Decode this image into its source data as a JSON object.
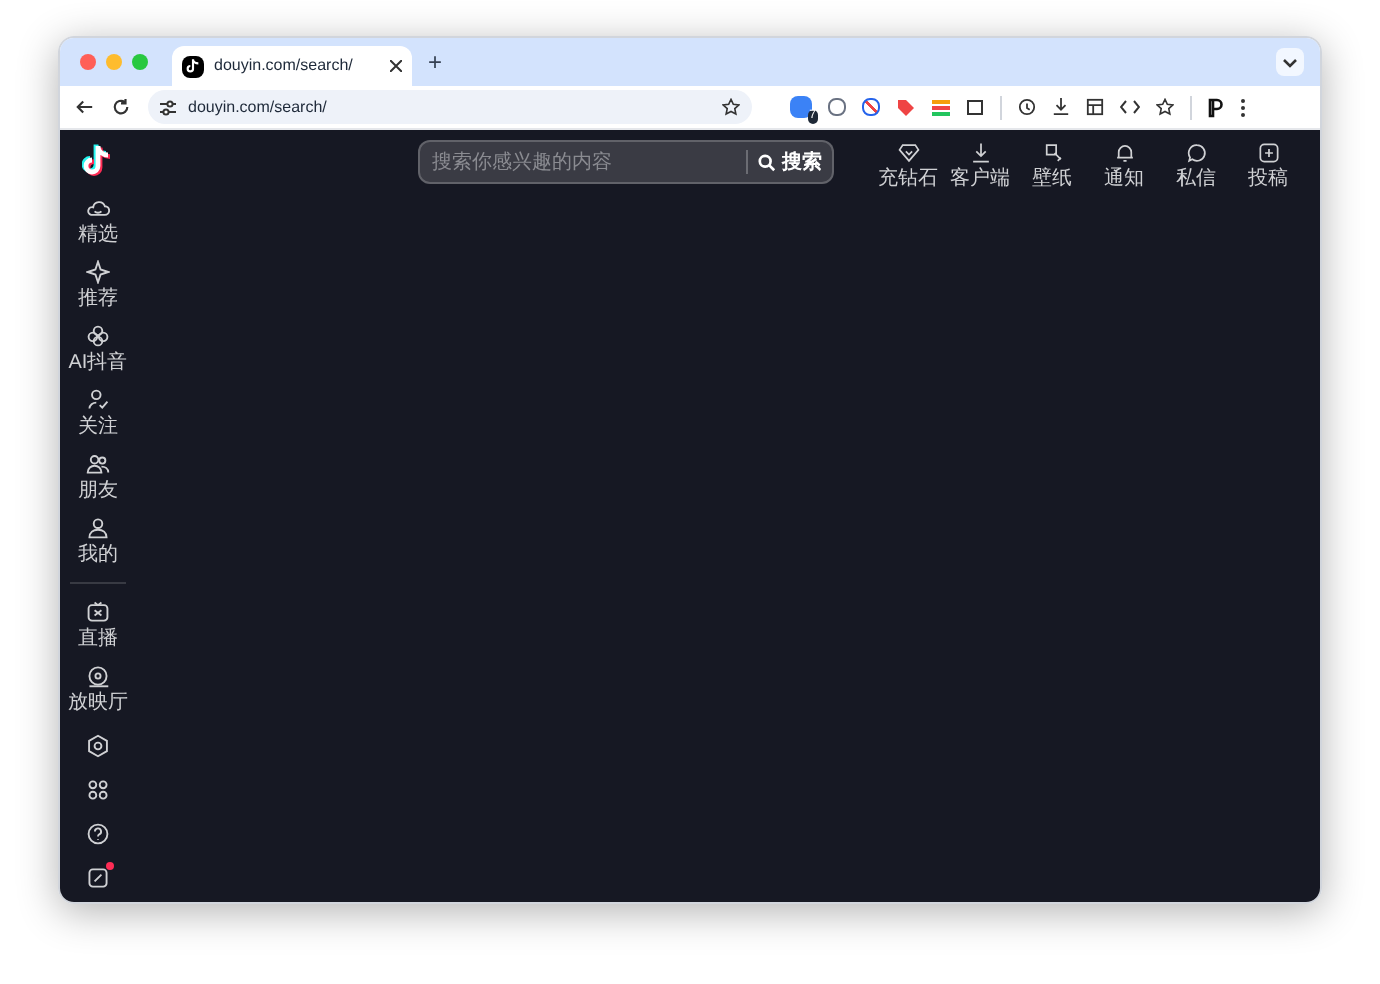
{
  "browser": {
    "tab": {
      "title": "douyin.com/search/",
      "selected": true
    },
    "new_tab": "+",
    "url": "douyin.com/search/",
    "extension_badge": "7"
  },
  "sidebar": {
    "top": [
      {
        "kind": "home",
        "label": "精选",
        "selected": false
      },
      {
        "kind": "spark",
        "label": "推荐",
        "selected": false
      },
      {
        "kind": "ai",
        "label": "AI抖音",
        "selected": false
      },
      {
        "kind": "follow",
        "label": "关注",
        "selected": false
      },
      {
        "kind": "friends",
        "label": "朋友",
        "selected": false
      },
      {
        "kind": "me",
        "label": "我的",
        "selected": false
      }
    ],
    "middle": [
      {
        "kind": "live",
        "label": "直播",
        "selected": false
      },
      {
        "kind": "cinema",
        "label": "放映厅",
        "selected": false
      }
    ],
    "bottom": [
      {
        "kind": "settings",
        "badge": false
      },
      {
        "kind": "apps",
        "badge": false
      },
      {
        "kind": "help",
        "badge": false
      },
      {
        "kind": "note",
        "badge": true
      }
    ]
  },
  "search": {
    "placeholder": "搜索你感兴趣的内容",
    "button": "搜索"
  },
  "header_actions": [
    {
      "kind": "diamond",
      "label": "充钻石"
    },
    {
      "kind": "download",
      "label": "客户端"
    },
    {
      "kind": "wallpaper",
      "label": "壁纸"
    },
    {
      "kind": "bell",
      "label": "通知"
    },
    {
      "kind": "chat",
      "label": "私信"
    },
    {
      "kind": "upload",
      "label": "投稿"
    }
  ]
}
